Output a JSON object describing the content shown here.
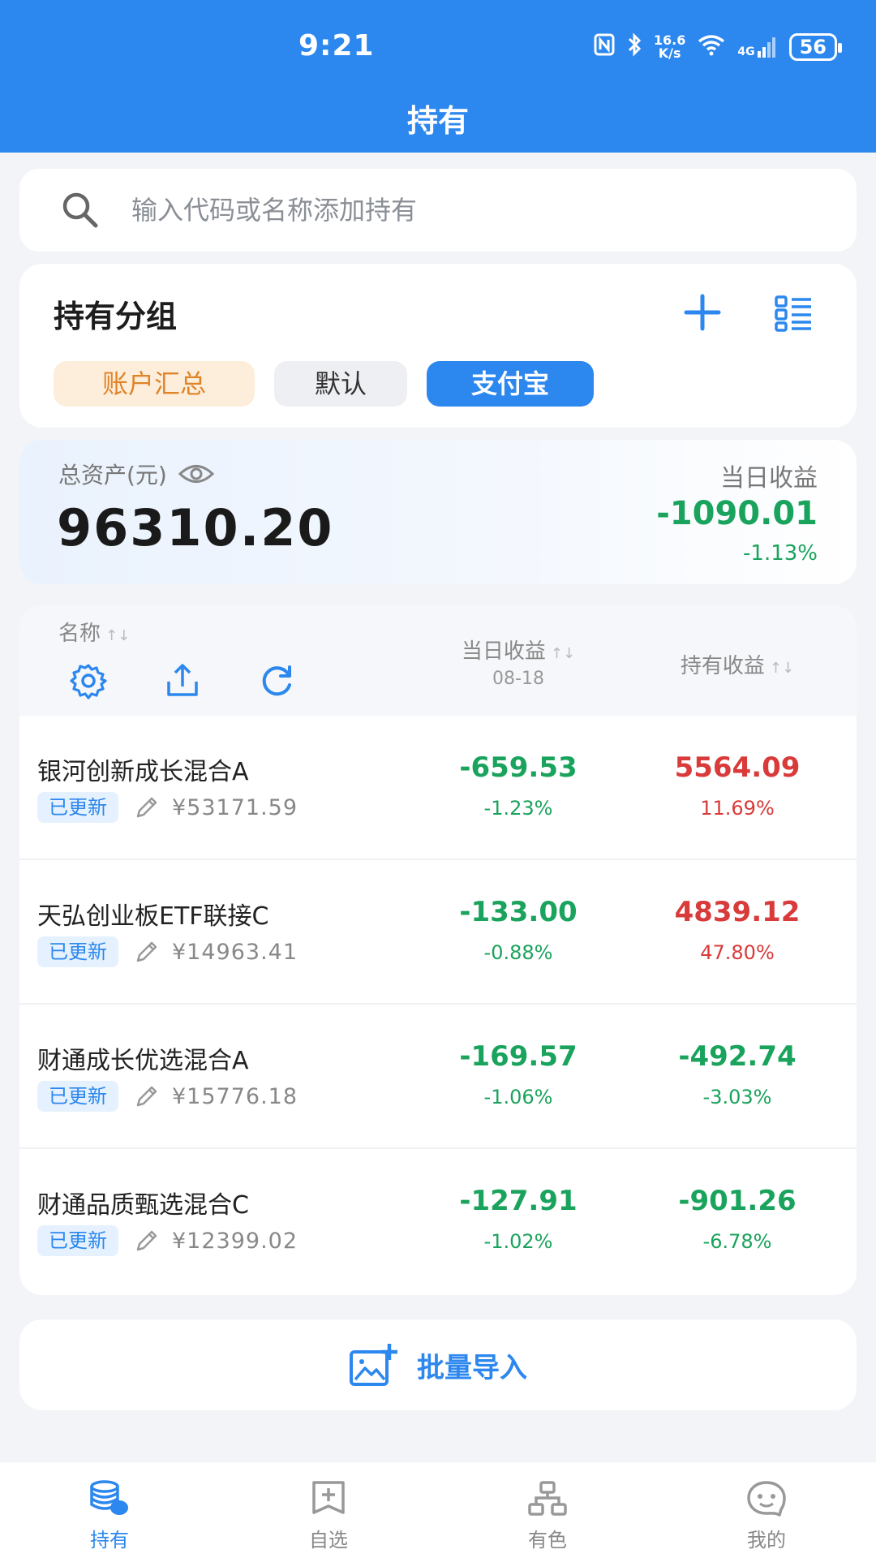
{
  "status_bar": {
    "time": "9:21",
    "net_speed_top": "16.6",
    "net_speed_bottom": "K/s",
    "battery": "56",
    "signal": "4G"
  },
  "header": {
    "title": "持有"
  },
  "search": {
    "placeholder": "输入代码或名称添加持有"
  },
  "groups": {
    "title": "持有分组",
    "chips": [
      "账户汇总",
      "默认",
      "支付宝"
    ],
    "active_chip": "支付宝"
  },
  "assets": {
    "total_label": "总资产(元)",
    "total_value": "96310.20",
    "day_label": "当日收益",
    "day_value": "-1090.01",
    "day_pct": "-1.13%"
  },
  "table": {
    "col_name": "名称",
    "col_day": "当日收益",
    "col_day_date": "08-18",
    "col_hold": "持有收益",
    "sort_glyph": "↑↓",
    "rows": [
      {
        "name": "银河创新成长混合A",
        "badge": "已更新",
        "amount": "¥53171.59",
        "day_value": "-659.53",
        "day_pct": "-1.23%",
        "hold_value": "5564.09",
        "hold_pct": "11.69%",
        "day_color": "green",
        "hold_color": "red"
      },
      {
        "name": "天弘创业板ETF联接C",
        "badge": "已更新",
        "amount": "¥14963.41",
        "day_value": "-133.00",
        "day_pct": "-0.88%",
        "hold_value": "4839.12",
        "hold_pct": "47.80%",
        "day_color": "green",
        "hold_color": "red"
      },
      {
        "name": "财通成长优选混合A",
        "badge": "已更新",
        "amount": "¥15776.18",
        "day_value": "-169.57",
        "day_pct": "-1.06%",
        "hold_value": "-492.74",
        "hold_pct": "-3.03%",
        "day_color": "green",
        "hold_color": "green"
      },
      {
        "name": "财通品质甄选混合C",
        "badge": "已更新",
        "amount": "¥12399.02",
        "day_value": "-127.91",
        "day_pct": "-1.02%",
        "hold_value": "-901.26",
        "hold_pct": "-6.78%",
        "day_color": "green",
        "hold_color": "green"
      }
    ]
  },
  "import": {
    "label": "批量导入"
  },
  "tabbar": {
    "tabs": [
      {
        "label": "持有",
        "icon": "coins-icon",
        "active": true
      },
      {
        "label": "自选",
        "icon": "bookmark-add-icon",
        "active": false
      },
      {
        "label": "有色",
        "icon": "hierarchy-icon",
        "active": false
      },
      {
        "label": "我的",
        "icon": "chat-face-icon",
        "active": false
      }
    ]
  },
  "colors": {
    "accent": "#2c87ee",
    "gain": "#d93a3a",
    "loss": "#1aa35c",
    "summary_chip_bg": "#fdeedb",
    "summary_chip_text": "#e08428"
  }
}
